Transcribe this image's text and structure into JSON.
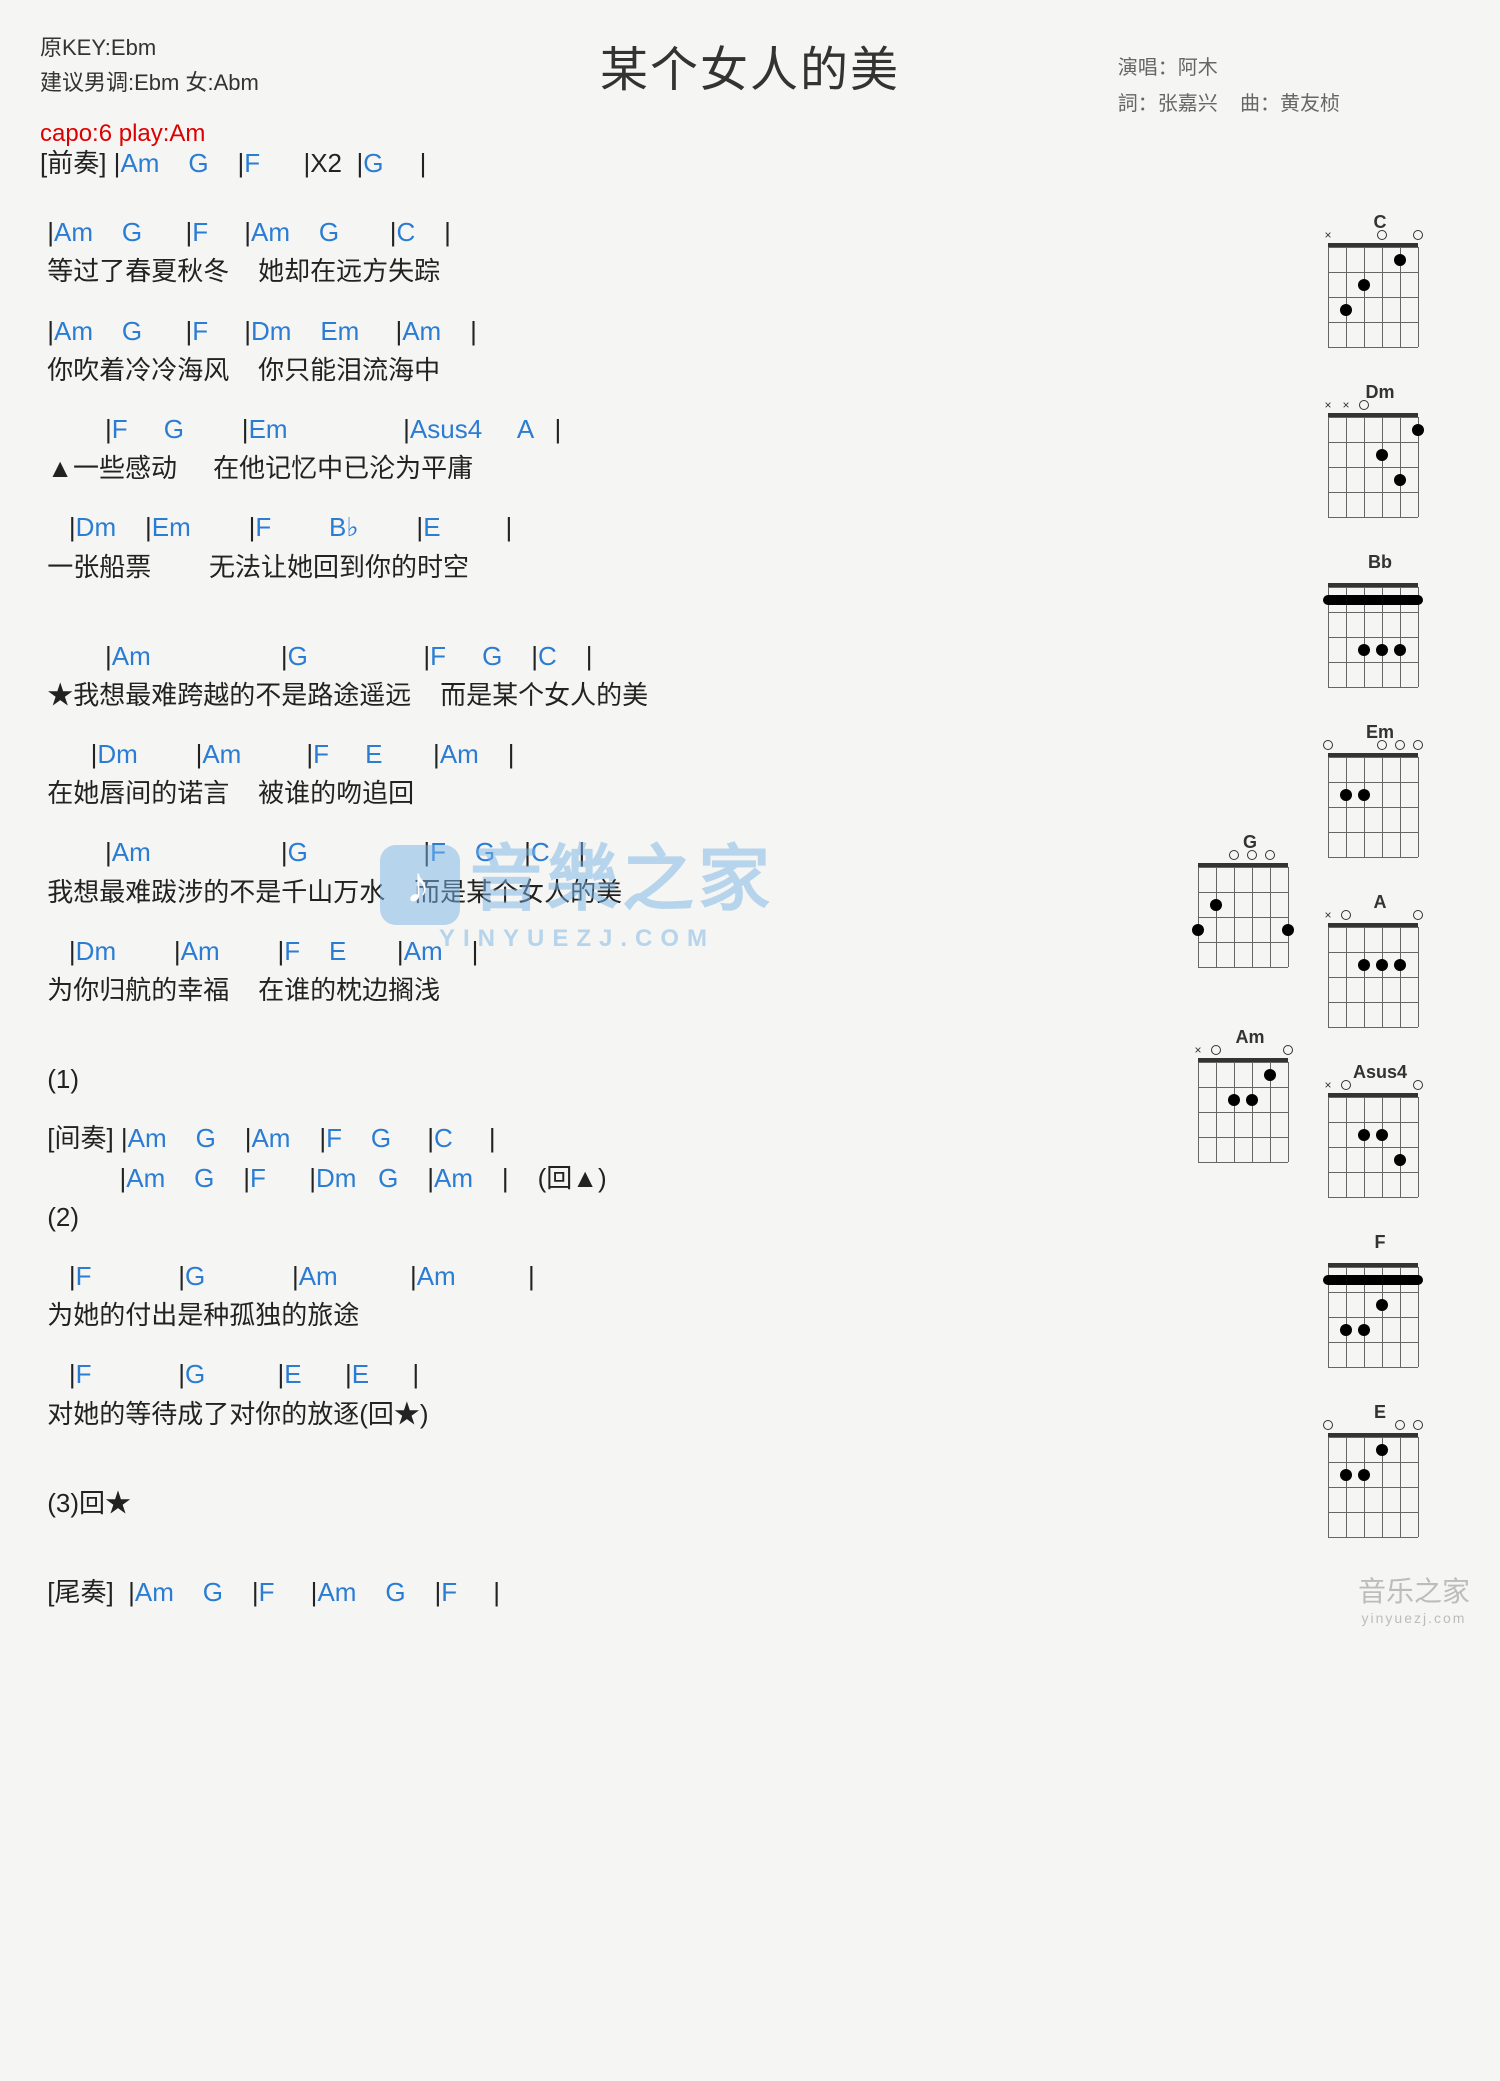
{
  "title": "某个女人的美",
  "key_info": {
    "original_key": "原KEY:Ebm",
    "suggested": "建议男调:Ebm  女:Abm"
  },
  "credits": {
    "singer_label": "演唱：",
    "singer": "阿木",
    "lyricist_label": "詞：",
    "lyricist": "张嘉兴",
    "composer_label": "曲：",
    "composer": "黄友桢"
  },
  "capo": "capo:6 play:Am",
  "lines": [
    {
      "type": "chord",
      "pre": "[前奏] ",
      "text": "|Am    G    |F      |X2  |G     |"
    },
    {
      "type": "gap"
    },
    {
      "type": "chord",
      "text": " |Am    G      |F     |Am    G       |C    |"
    },
    {
      "type": "lyric",
      "text": " 等过了春夏秋冬    她却在远方失踪"
    },
    {
      "type": "chord",
      "text": " |Am    G      |F     |Dm    Em     |Am    |"
    },
    {
      "type": "lyric",
      "text": " 你吹着冷冷海风    你只能泪流海中"
    },
    {
      "type": "chord",
      "text": "         |F     G        |Em                |Asus4     A   |"
    },
    {
      "type": "lyric",
      "text": " ▲一些感动     在他记忆中已沦为平庸"
    },
    {
      "type": "chord",
      "text": "    |Dm    |Em        |F        B♭        |E         |"
    },
    {
      "type": "lyric",
      "text": " 一张船票        无法让她回到你的时空"
    },
    {
      "type": "gap"
    },
    {
      "type": "chord",
      "text": "         |Am                  |G                |F     G    |C    |"
    },
    {
      "type": "lyric",
      "text": " ★我想最难跨越的不是路途遥远    而是某个女人的美"
    },
    {
      "type": "chord",
      "text": "       |Dm        |Am         |F     E       |Am    |"
    },
    {
      "type": "lyric",
      "text": " 在她唇间的诺言    被谁的吻追回"
    },
    {
      "type": "chord",
      "text": "         |Am                  |G                |F    G    |C    |"
    },
    {
      "type": "lyric",
      "text": " 我想最难跋涉的不是千山万水    而是某个女人的美"
    },
    {
      "type": "chord",
      "text": "    |Dm        |Am        |F    E       |Am    |"
    },
    {
      "type": "lyric",
      "text": " 为你归航的幸福    在谁的枕边搁浅"
    },
    {
      "type": "gap"
    },
    {
      "type": "lyric",
      "text": " (1)"
    },
    {
      "type": "chord",
      "pre": " [间奏] ",
      "text": "|Am    G    |Am    |F    G     |C     |"
    },
    {
      "type": "chord",
      "text": "           |Am    G    |F      |Dm   G    |Am    |    (回▲)"
    },
    {
      "type": "lyric",
      "text": " (2)"
    },
    {
      "type": "chord",
      "text": "    |F            |G            |Am          |Am          |"
    },
    {
      "type": "lyric",
      "text": " 为她的付出是种孤独的旅途"
    },
    {
      "type": "chord",
      "text": "    |F            |G          |E      |E      |"
    },
    {
      "type": "lyric",
      "text": " 对她的等待成了对你的放逐(回★)"
    },
    {
      "type": "gap"
    },
    {
      "type": "lyric",
      "text": " (3)回★"
    },
    {
      "type": "gap"
    },
    {
      "type": "chord",
      "pre": " [尾奏]  ",
      "text": "|Am    G    |F     |Am    G    |F     |"
    }
  ],
  "chord_diagrams": [
    "C",
    "Dm",
    "Bb",
    "Em",
    "A",
    "G",
    "Asus4",
    "Am",
    "F",
    "E"
  ],
  "watermark": {
    "main": "音樂之家",
    "sub": "YINYUEZJ.COM"
  },
  "corner": {
    "main": "音乐之家",
    "sub": "yinyuezj.com"
  },
  "chart_data": {
    "type": "table",
    "title": "Guitar chord chart — 某个女人的美",
    "chords_used": [
      "Am",
      "G",
      "F",
      "C",
      "Dm",
      "Em",
      "Asus4",
      "A",
      "Bb",
      "E"
    ],
    "capo": 6,
    "play_key": "Am",
    "original_key": "Ebm"
  }
}
